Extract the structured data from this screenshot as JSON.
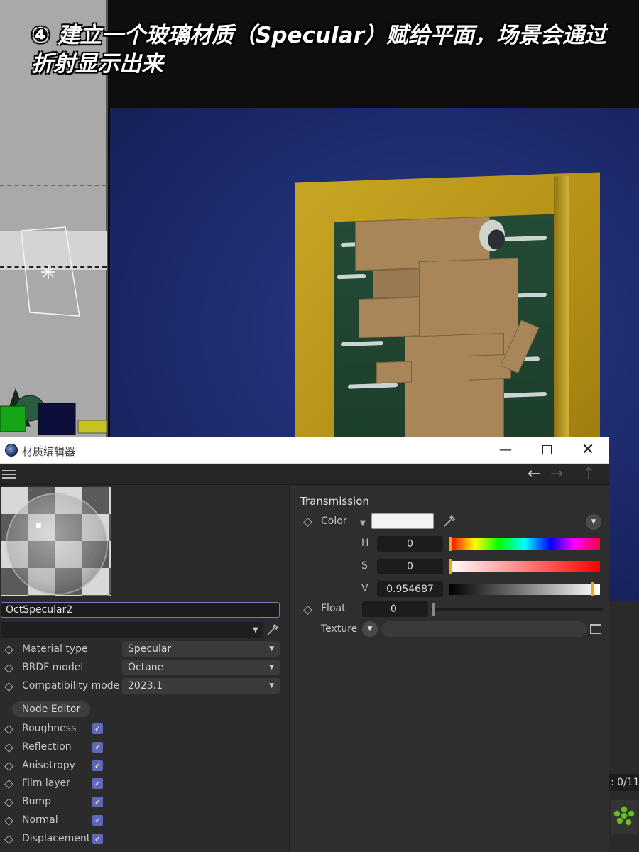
{
  "caption": "④ 建立一个玻璃材质（Specular）赋给平面，场景会通过折射显示出来",
  "window": {
    "title": "材质编辑器",
    "min_symbol": "—",
    "close_symbol": "✕"
  },
  "toolbar": {
    "back": "←",
    "forward": "→",
    "up": "↑"
  },
  "material": {
    "name": "OctSpecular2",
    "params": [
      {
        "label": "Material type",
        "value": "Specular"
      },
      {
        "label": "BRDF model",
        "value": "Octane"
      },
      {
        "label": "Compatibility mode",
        "value": "2023.1"
      }
    ],
    "node_editor_label": "Node Editor",
    "channels": [
      {
        "label": "Roughness",
        "checked": true
      },
      {
        "label": "Reflection",
        "checked": true
      },
      {
        "label": "Anisotropy",
        "checked": true
      },
      {
        "label": "Film layer",
        "checked": true
      },
      {
        "label": "Bump",
        "checked": true
      },
      {
        "label": "Normal",
        "checked": true
      },
      {
        "label": "Displacement",
        "checked": true
      }
    ]
  },
  "transmission": {
    "title": "Transmission",
    "color_label": "Color",
    "color_hex": "#f3f3f3",
    "h_label": "H",
    "h_value": "0",
    "s_label": "S",
    "s_value": "0",
    "v_label": "V",
    "v_value": "0.954687",
    "float_label": "Float",
    "float_value": "0",
    "texture_label": "Texture"
  },
  "side_status": ": 0/11",
  "colors": {
    "accent_checkbox": "#5e67b8",
    "slider_knob": "#f0a818",
    "render_background": "#1d2a6d",
    "frame_gold": "#c8a624"
  }
}
